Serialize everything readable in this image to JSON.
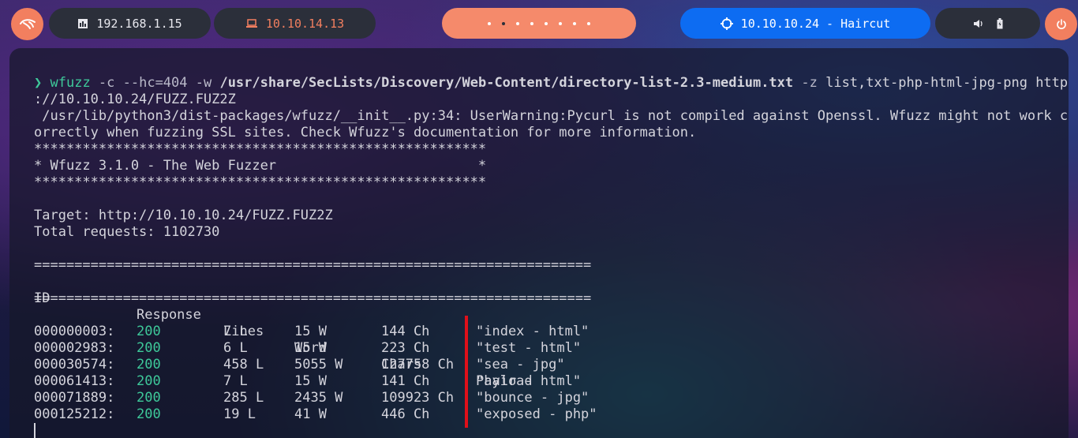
{
  "topbar": {
    "left_pill_ip": "192.168.1.15",
    "vpn_ip": "10.10.14.13",
    "target": "10.10.10.24 - Haircut",
    "workspace_count": 8,
    "active_workspace": 2
  },
  "terminal": {
    "prompt_symbol": "❯",
    "command": {
      "bin": "wfuzz",
      "args1": " -c --hc=404 -w ",
      "wordlist": "/usr/share/SecLists/Discovery/Web-Content/directory-list-2.3-medium.txt",
      "args2": " -z ",
      "args3": "list,txt-php-html-jpg-png http",
      "url_cont": "://10.10.10.24/FUZZ.FUZ2Z"
    },
    "warning_1": " /usr/lib/python3/dist-packages/wfuzz/__init__.py:34: UserWarning:Pycurl is not compiled against Openssl. Wfuzz might not work c",
    "warning_2": "orrectly when fuzzing SSL sites. Check Wfuzz's documentation for more information.",
    "stars": "********************************************************",
    "banner": "* Wfuzz 3.1.0 - The Web Fuzzer                         *",
    "target_line": "Target: http://10.10.10.24/FUZZ.FUZ2Z",
    "total_line": "Total requests: 1102730",
    "rule": "=====================================================================",
    "headers": {
      "id": "ID",
      "response": "Response",
      "lines": "Lines",
      "word": "Word",
      "chars": "Chars",
      "payload": "Payload"
    },
    "rows": [
      {
        "id": "000000003:",
        "code": "200",
        "lines": "7 L",
        "words": "15 W",
        "chars": "144 Ch",
        "payload": "\"index - html\""
      },
      {
        "id": "000002983:",
        "code": "200",
        "lines": "6 L",
        "words": "15 W",
        "chars": "223 Ch",
        "payload": "\"test - html\""
      },
      {
        "id": "000030574:",
        "code": "200",
        "lines": "458 L",
        "words": "5055 W",
        "chars": "127758 Ch",
        "payload": "\"sea - jpg\""
      },
      {
        "id": "000061413:",
        "code": "200",
        "lines": "7 L",
        "words": "15 W",
        "chars": "141 Ch",
        "payload": "\"hair - html\""
      },
      {
        "id": "000071889:",
        "code": "200",
        "lines": "285 L",
        "words": "2435 W",
        "chars": "109923 Ch",
        "payload": "\"bounce - jpg\""
      },
      {
        "id": "000125212:",
        "code": "200",
        "lines": "19 L",
        "words": "41 W",
        "chars": "446 Ch",
        "payload": "\"exposed - php\""
      }
    ]
  }
}
